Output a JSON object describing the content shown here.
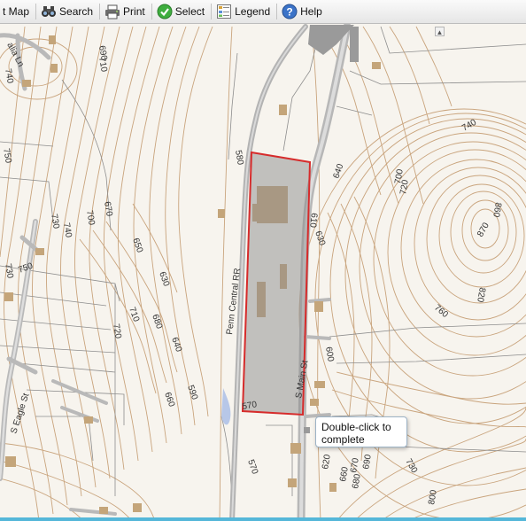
{
  "toolbar": {
    "items": [
      {
        "label": "t Map",
        "icon": "map-icon"
      },
      {
        "label": "Search",
        "icon": "binoculars-icon"
      },
      {
        "label": "Print",
        "icon": "printer-icon"
      },
      {
        "label": "Select",
        "icon": "check-circle-icon"
      },
      {
        "label": "Legend",
        "icon": "legend-icon"
      },
      {
        "label": "Help",
        "icon": "question-icon"
      }
    ]
  },
  "tooltip": {
    "line1": "Double-click to",
    "line2": "complete"
  },
  "map": {
    "street_labels": [
      "Penn Central RR",
      "S Main St",
      "S Eagle St",
      "alia Ln"
    ],
    "contour_labels": [
      "690",
      "710",
      "740",
      "750",
      "730",
      "700",
      "670",
      "740",
      "730",
      "750",
      "650",
      "630",
      "710",
      "680",
      "640",
      "720",
      "660",
      "590",
      "580",
      "610",
      "630",
      "640",
      "700",
      "720",
      "740",
      "860",
      "870",
      "820",
      "760",
      "600",
      "570",
      "570",
      "620",
      "660",
      "670",
      "680",
      "690",
      "730",
      "800"
    ],
    "colors": {
      "background": "#f7f4ee",
      "contour": "#c9a47d",
      "selection_border": "#d62b2b",
      "selection_fill": "#8c8c8c",
      "building": "#c4a57a",
      "road": "#b9b9b9",
      "parcel_line": "#8d8d8d",
      "water": "#b7c7e8"
    }
  }
}
